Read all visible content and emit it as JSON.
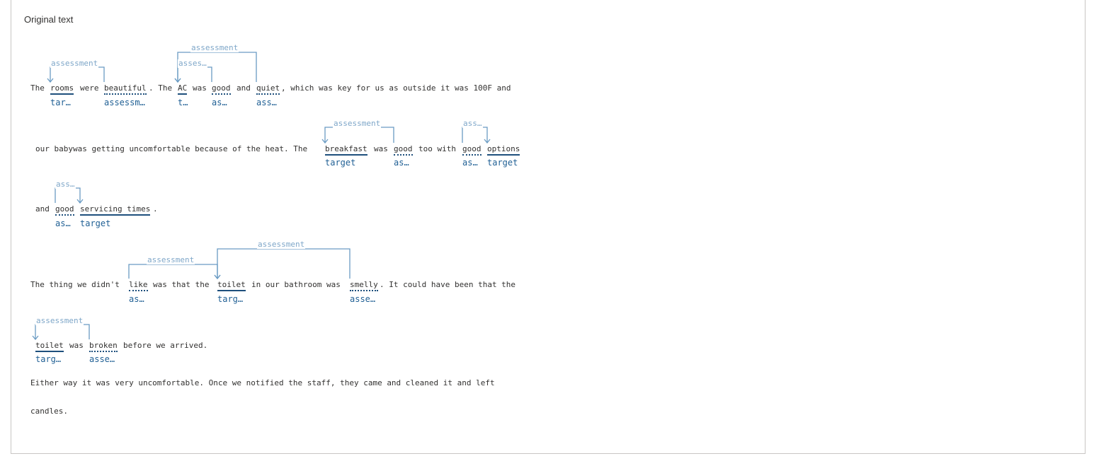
{
  "panel": {
    "title": "Original text"
  },
  "words": [
    {
      "t": "The",
      "c": "p"
    },
    {
      "t": "rooms",
      "c": "t"
    },
    {
      "t": "were",
      "c": "p"
    },
    {
      "t": "beautiful",
      "c": "a"
    },
    {
      "t": ". The",
      "c": "p"
    },
    {
      "t": "AC",
      "c": "t"
    },
    {
      "t": "was",
      "c": "p"
    },
    {
      "t": "good",
      "c": "a"
    },
    {
      "t": "and",
      "c": "p"
    },
    {
      "t": "quiet",
      "c": "a"
    },
    {
      "t": ", which was key for us as outside it was 100F and",
      "c": "p"
    },
    {
      "t": "our babywas getting uncomfortable because of the heat. The",
      "c": "p"
    },
    {
      "t": "breakfast",
      "c": "t"
    },
    {
      "t": "was",
      "c": "p"
    },
    {
      "t": "good",
      "c": "a"
    },
    {
      "t": "too with",
      "c": "p"
    },
    {
      "t": "good",
      "c": "a"
    },
    {
      "t": "options",
      "c": "t"
    },
    {
      "t": "and",
      "c": "p"
    },
    {
      "t": "good",
      "c": "a"
    },
    {
      "t": "servicing times",
      "c": "t"
    },
    {
      "t": ".",
      "c": "p"
    },
    {
      "t": "The thing we didn't",
      "c": "p"
    },
    {
      "t": "like",
      "c": "a"
    },
    {
      "t": "was that the",
      "c": "p"
    },
    {
      "t": "toilet",
      "c": "t"
    },
    {
      "t": "in our bathroom was",
      "c": "p"
    },
    {
      "t": "smelly",
      "c": "a"
    },
    {
      "t": ". It could have been that the",
      "c": "p"
    },
    {
      "t": "toilet",
      "c": "t"
    },
    {
      "t": "was",
      "c": "p"
    },
    {
      "t": "broken",
      "c": "a"
    },
    {
      "t": "before we arrived.",
      "c": "p"
    },
    {
      "t": "Either way it was very uncomfortable. Once we notified the staff, they came and cleaned it and left",
      "c": "p"
    },
    {
      "t": "candles.",
      "c": "p"
    }
  ],
  "entity_labels": [
    "tar…",
    "assessm…",
    "t…",
    "as…",
    "ass…",
    "target",
    "as…",
    "as…",
    "target",
    "as…",
    "target",
    "as…",
    "targ…",
    "asse…",
    "targ…",
    "asse…"
  ],
  "relation_labels": [
    "assessment",
    "assessment",
    "asses…",
    "assessment",
    "ass…",
    "ass…",
    "assessment",
    "assessment",
    "assessment"
  ],
  "colors": {
    "target_underline": "#1e4f7c",
    "assessment_underline": "#1e4f7c",
    "entity_label": "#1f5f94",
    "relation": "#6a9bc3"
  }
}
